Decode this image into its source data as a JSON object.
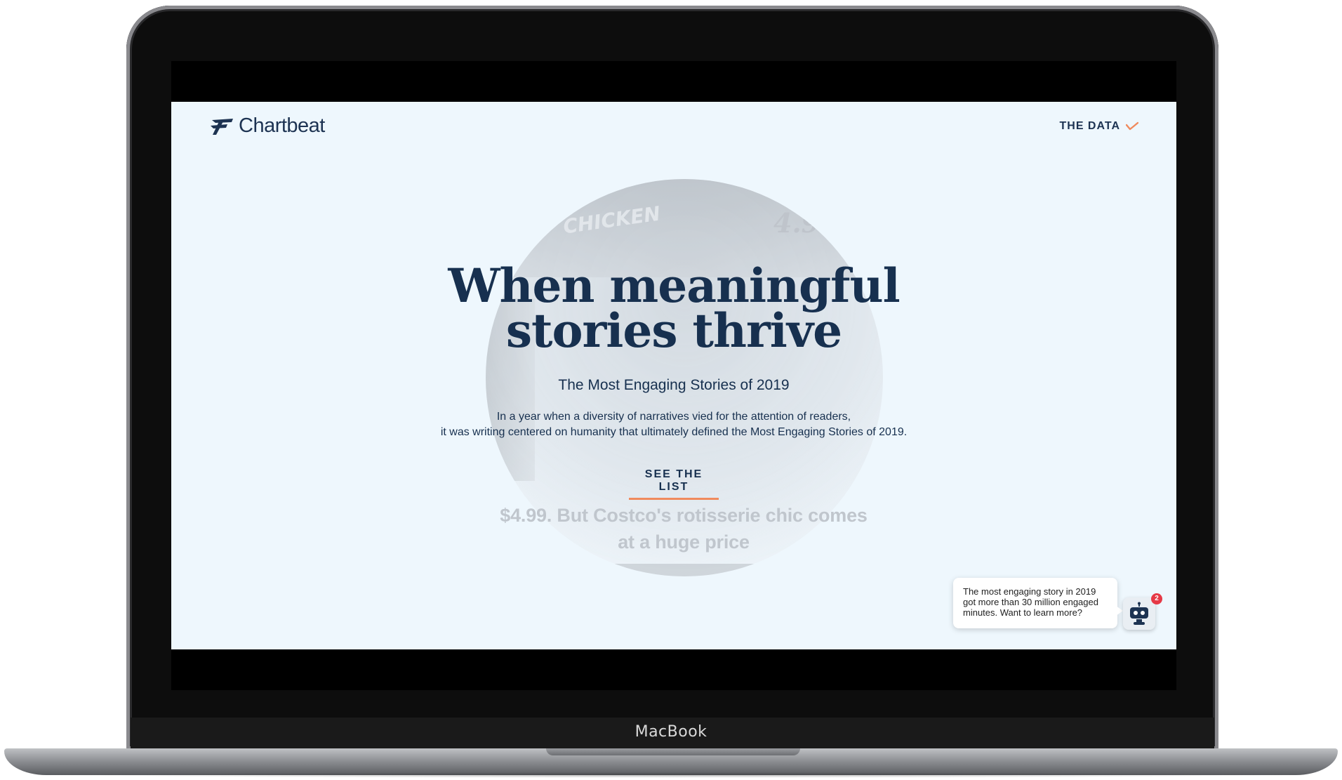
{
  "device": {
    "brand_label": "MacBook"
  },
  "header": {
    "logo_text": "Chartbeat",
    "nav_label": "THE DATA"
  },
  "background_image": {
    "sign_text": "CHICKEN",
    "price_text": "4.9",
    "headline_text": "$4.99. But Costco's rotisserie chic comes at a huge price"
  },
  "hero": {
    "title_line1": "When meaningful",
    "title_line2": "stories thrive",
    "subtitle": "The Most Engaging Stories of 2019",
    "description_line1": "In a year when a diversity of narratives vied for the attention of readers,",
    "description_line2": "it was writing centered on humanity that ultimately defined the Most Engaging Stories of 2019.",
    "cta_label": "SEE THE LIST"
  },
  "chat": {
    "message": "The most engaging story in 2019 got more than 30 million engaged minutes. Want to learn more?",
    "badge_count": "2"
  },
  "colors": {
    "navy": "#17304f",
    "accent": "#f08a5d",
    "screen_bg": "#eef7fd",
    "badge": "#e63946"
  }
}
